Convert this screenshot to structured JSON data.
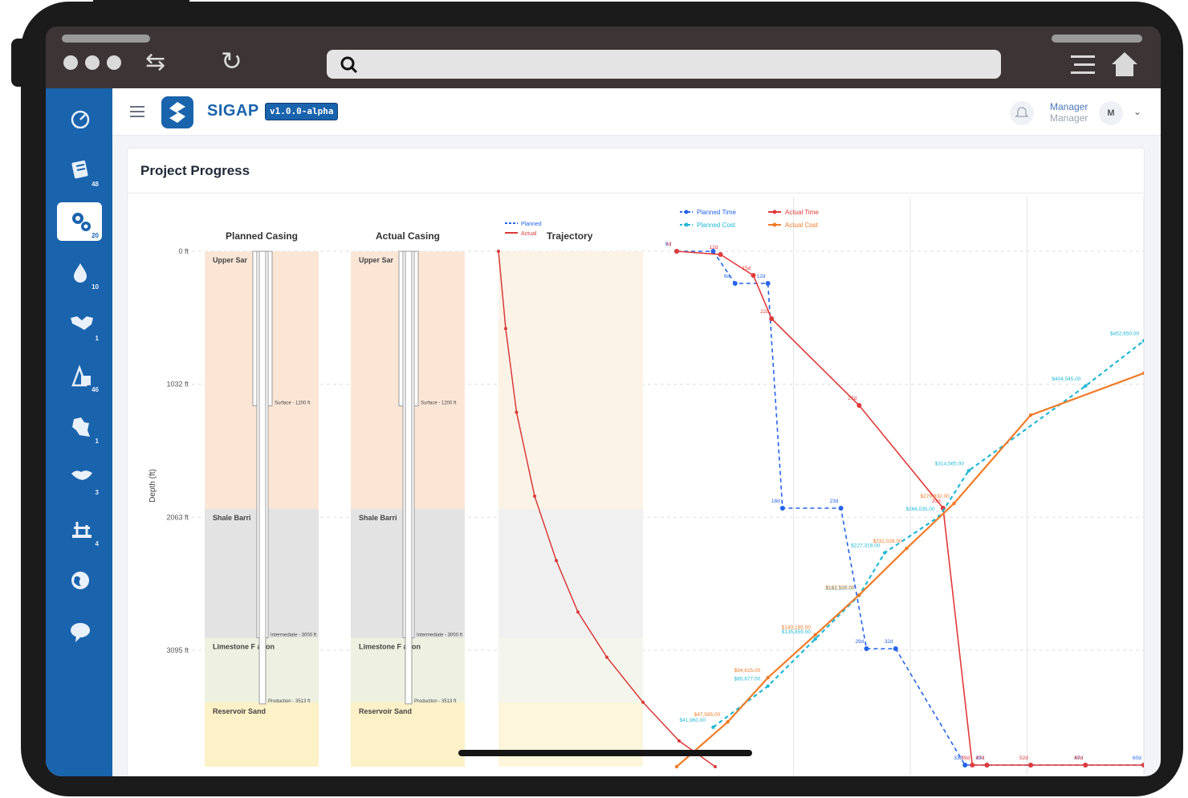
{
  "app": {
    "brand": "SIGAP",
    "version": "v1.0.0-alpha",
    "user_name": "Manager",
    "user_role": "Manager",
    "avatar_initial": "M"
  },
  "sidebar": {
    "items": [
      {
        "icon": "speedometer-icon",
        "badge": ""
      },
      {
        "icon": "document-list-icon",
        "badge": "48"
      },
      {
        "icon": "gears-icon",
        "badge": "20",
        "active": true
      },
      {
        "icon": "droplet-icon",
        "badge": "10"
      },
      {
        "icon": "handshake-icon",
        "badge": "1"
      },
      {
        "icon": "oil-pump-icon",
        "badge": "46"
      },
      {
        "icon": "map-region-icon",
        "badge": "1"
      },
      {
        "icon": "island-icon",
        "badge": "3"
      },
      {
        "icon": "oil-rig-icon",
        "badge": "4"
      },
      {
        "icon": "globe-icon",
        "badge": ""
      },
      {
        "icon": "chat-bubble-icon",
        "badge": ""
      }
    ]
  },
  "card": {
    "title": "Project Progress"
  },
  "chart_data": [
    {
      "type": "well-schematic",
      "panels": [
        "Planned Casing",
        "Actual Casing"
      ],
      "ylabel": "Depth (ft)",
      "ytick_labels": [
        "0 ft",
        "1032 ft",
        "2063 ft",
        "3095 ft"
      ],
      "formations": [
        {
          "name": "Upper Sar",
          "top": 0,
          "bottom": 2000,
          "color": "#fbe6d6"
        },
        {
          "name": "Shale Barri",
          "top": 2000,
          "bottom": 3000,
          "color": "#e3e3e3"
        },
        {
          "name": "Limestone F ation",
          "top": 3000,
          "bottom": 3500,
          "color": "#eef1e1"
        },
        {
          "name": "Reservoir Sand",
          "top": 3500,
          "bottom": 4000,
          "color": "#fdf1c8"
        }
      ],
      "casings": [
        {
          "label": "Surface - 1200 ft",
          "depth": 1200
        },
        {
          "label": "Intermediate - 3000 ft",
          "depth": 3000
        },
        {
          "label": "Production - 3513 ft",
          "depth": 3513
        }
      ]
    },
    {
      "type": "line",
      "title": "Trajectory",
      "legend": [
        "Planned",
        "Actual"
      ],
      "series": [
        {
          "name": "Actual",
          "color": "#d93a3a",
          "x": [
            0,
            10,
            25,
            50,
            80,
            110,
            150,
            200,
            250,
            300
          ],
          "y": [
            0,
            600,
            1250,
            1900,
            2400,
            2800,
            3150,
            3500,
            3800,
            4000
          ]
        }
      ]
    },
    {
      "type": "line",
      "legend": [
        "Planned Time",
        "Actual Time",
        "Planned Cost",
        "Actual Cost"
      ],
      "series": [
        {
          "name": "Planned Time",
          "color": "#2563eb",
          "dashed": true,
          "x": [
            0,
            10,
            16,
            25,
            29,
            45,
            52,
            60,
            79,
            85,
            97,
            112,
            128
          ],
          "y": [
            0,
            0,
            40,
            40,
            320,
            320,
            495,
            495,
            640,
            640,
            640,
            640,
            640
          ],
          "labels": [
            "6d",
            "",
            "9d",
            "12d",
            "18d",
            "23d",
            "29d",
            "32d",
            "33d",
            "39d",
            "",
            "47d",
            "60d"
          ]
        },
        {
          "name": "Actual Time",
          "color": "#e03a3a",
          "dashed": false,
          "x": [
            0,
            12,
            21,
            26,
            50,
            73,
            81,
            85,
            97,
            112,
            128
          ],
          "y": [
            0,
            4,
            30,
            84,
            192,
            320,
            640,
            640,
            640,
            640,
            640
          ],
          "labels": [
            "7d",
            "12d",
            "15d",
            "22d",
            "27d",
            "33d",
            "39d",
            "47d",
            "52d",
            "60d"
          ]
        },
        {
          "name": "Planned Cost",
          "color": "#22b8d6",
          "dashed": true,
          "x": [
            10,
            25,
            38,
            50,
            57,
            72,
            80,
            112,
            128
          ],
          "y": [
            41960,
            85677,
            135855,
            182120,
            227319,
            266035,
            314565,
            404545,
            452650
          ],
          "labels": [
            "$41,960.00",
            "$85,677.00",
            "$135,855.00",
            "$182,120.00",
            "$227,319.00",
            "$266,035.00",
            "$314,565.00",
            "$404,545.00",
            "$452,650.00"
          ]
        },
        {
          "name": "Actual Cost",
          "color": "#f07b27",
          "dashed": false,
          "x": [
            0,
            14,
            25,
            38,
            50,
            63,
            76,
            97,
            128
          ],
          "y": [
            0,
            47595,
            94615,
            140195,
            182505,
            232026,
            279832,
            373646,
            418246
          ],
          "labels": [
            "",
            "$47,595.00",
            "$94,615.00",
            "$140,195.00",
            "$182,505.00",
            "$232,026.00",
            "$279,832.00",
            "",
            ""
          ]
        }
      ]
    }
  ]
}
